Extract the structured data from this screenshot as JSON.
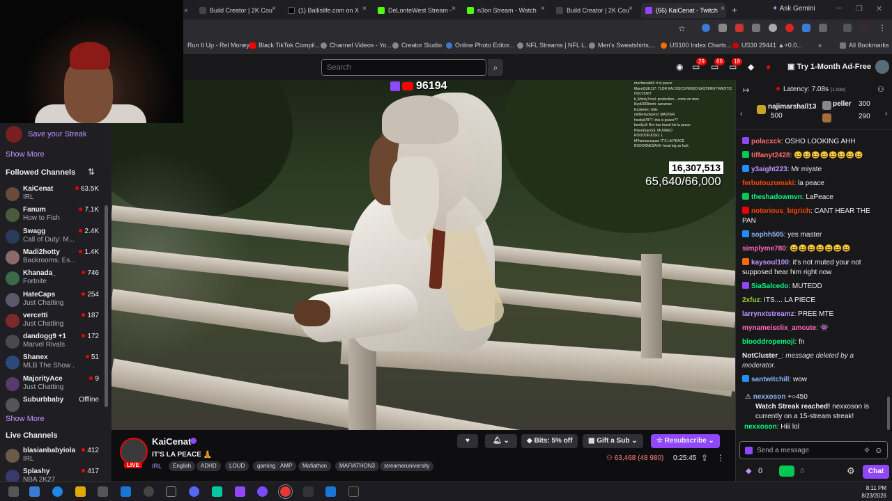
{
  "browser": {
    "tabs": [
      {
        "label": "Build Creator | 2K Cou",
        "color": "#444"
      },
      {
        "label": "(1) Ballislife.com on X",
        "color": "#000"
      },
      {
        "label": "DeLonteWest Stream -",
        "color": "#53fc18"
      },
      {
        "label": "n3on Stream - Watch",
        "color": "#53fc18"
      },
      {
        "label": "Build Creator | 2K Cou",
        "color": "#444"
      },
      {
        "label": "(66) KaiCenat - Twitch",
        "color": "#9146ff"
      }
    ],
    "new_tab": "+",
    "gemini": "Ask Gemini",
    "bookmarks": [
      {
        "label": "Run It Up - Rel Money",
        "color": "#666"
      },
      {
        "label": "Black TikTok Compil...",
        "color": "#ff0000"
      },
      {
        "label": "Channel Videos - Yo...",
        "color": "#888"
      },
      {
        "label": "Creator Studio",
        "color": "#888"
      },
      {
        "label": "Online Photo Editor...",
        "color": "#3a7bd5"
      },
      {
        "label": "NFL Streams | NFL L...",
        "color": "#888"
      },
      {
        "label": "Men's Sweatshirts,...",
        "color": "#888"
      },
      {
        "label": "US100 Index Charts...",
        "color": "#ff6a00"
      },
      {
        "label": "US30 29441 ▲+0.0...",
        "color": "#c00"
      }
    ],
    "all_bookmarks": "All Bookmarks"
  },
  "twitch_nav": {
    "search_placeholder": "Search",
    "badges": [
      "29",
      "66",
      "18"
    ],
    "ad_free": "Try 1-Month Ad-Free"
  },
  "sidebar": {
    "streak": "Save your Streak",
    "show_more_1": "Show More",
    "followed_heading": "Followed Channels",
    "followed": [
      {
        "name": "KaiCenat",
        "game": "IRL",
        "viewers": "63.5K",
        "color": "#6a4a3a"
      },
      {
        "name": "Fanum",
        "game": "How to Fish",
        "viewers": "7.1K",
        "color": "#4a5a3a"
      },
      {
        "name": "Swagg",
        "game": "Call of Duty: M...",
        "viewers": "2.4K",
        "color": "#2a3a5a"
      },
      {
        "name": "Madi2hotty",
        "game": "Backrooms: Es...",
        "viewers": "1.4K",
        "color": "#8a6a6a"
      },
      {
        "name": "Khanada_",
        "game": "Fortnite",
        "viewers": "746",
        "color": "#3a6a4a"
      },
      {
        "name": "HateCaps",
        "game": "Just Chatting",
        "viewers": "254",
        "color": "#5a5a6a"
      },
      {
        "name": "vercetti",
        "game": "Just Chatting",
        "viewers": "187",
        "color": "#7a2a2a"
      },
      {
        "name": "dandogg9 +1",
        "game": "Marvel Rivals",
        "viewers": "172",
        "color": "#4a4a4a"
      },
      {
        "name": "Shanex",
        "game": "MLB The Show ...",
        "viewers": "51",
        "color": "#2a4a7a"
      },
      {
        "name": "MajorityAce",
        "game": "Just Chatting",
        "viewers": "9",
        "color": "#5a3a6a"
      },
      {
        "name": "Suburbbaby",
        "game": "",
        "viewers": "Offline",
        "color": "#555"
      }
    ],
    "show_more_2": "Show More",
    "live_heading": "Live Channels",
    "live": [
      {
        "name": "blasianbabyiola",
        "game": "IRL",
        "viewers": "412",
        "color": "#6a5a4a"
      },
      {
        "name": "Splashy",
        "game": "NBA 2K27",
        "viewers": "417",
        "color": "#3a3a6a"
      }
    ]
  },
  "video": {
    "viewer_total": "96194",
    "goal_count": "16,307,513",
    "goal_progress": "65,640/66,000",
    "overlay_chat": [
      "rbuchenahd1: it is peace",
      "MannQUE117: TLDR KAI DISCOVERED EASTERN TRADITIONS",
      "HOLYSHIT",
      "ti_Monty7cool: production... come on men",
      "lloyd2009mnh: wavwww",
      "EaJamex: vidis",
      "mittlerdudeprod: MASTER",
      "hosikjd7877: this is peace??",
      "bentlyx3: Bro has found his la peace",
      "PlanetSanGS: MUDRED",
      "ROOODRJDSG: L",
      "kPharmacequat: IT'S LA PEACE",
      "BODONNESAXX: head big as fuck"
    ]
  },
  "stream_info": {
    "channel": "KaiCenat",
    "live": "LIVE",
    "title": "IT'S LA PEACE 🧘",
    "category": "IRL",
    "tags": [
      "English",
      "ADHD",
      "LOUD",
      "gaming",
      "AMP",
      "Mafiathon",
      "MAFIATHON3",
      "streameruniversity"
    ],
    "bits": "Bits: 5% off",
    "gift": "Gift a Sub",
    "resub": "Resubscribe",
    "viewers": "63,468 (48 980)",
    "uptime": "0:25:45"
  },
  "chat": {
    "latency": "Latency: 7.08s",
    "latency_sub": "(1.03x)",
    "leaderboard": [
      {
        "name": "najimarshall13",
        "score": "500"
      },
      {
        "name": "peller",
        "score": "300"
      },
      {
        "name": "",
        "score": "290"
      }
    ],
    "messages": [
      {
        "user": "polacxck",
        "color": "#ff6b6b",
        "text": ": OSHO LOOKING AHH",
        "badge": "#9146ff"
      },
      {
        "user": "tiffanyt2428",
        "color": "#ff6b6b",
        "text": ": 😆😆😆😆😆😆😆😆",
        "badge": "#00c853"
      },
      {
        "user": "y3aight223",
        "color": "#bf94ff",
        "text": ": Mr miyate",
        "badge": "#1e90ff"
      },
      {
        "user": "ferbutouzumaki",
        "color": "#ff4500",
        "text": ": la peace",
        "badge": ""
      },
      {
        "user": "theshadowmvn",
        "color": "#00ff7f",
        "text": ": LaPeace",
        "badge": "#00c853"
      },
      {
        "user": "notorious_bigrich",
        "color": "#ff4500",
        "text": ": CANT HEAR THE PAN",
        "badge": "#eb0400"
      },
      {
        "user": "sophh505",
        "color": "#8ab4f8",
        "text": ": yes master",
        "badge": "#1e90ff"
      },
      {
        "user": "simplyme780",
        "color": "#ff69b4",
        "text": ": 😆😆😆😆😆😆😆",
        "badge": ""
      },
      {
        "user": "kaysoul100",
        "color": "#bf94ff",
        "text": ": it's not muted your not supposed hear him right now",
        "badge": "#ff6a00"
      },
      {
        "user": "SiaSalcedo",
        "color": "#00ff7f",
        "text": ": MUTEDD",
        "badge": "#9146ff"
      },
      {
        "user": "2xfuz",
        "color": "#9acd32",
        "text": ": ITS.... LA PIECE",
        "badge": ""
      },
      {
        "user": "larrynxtstreamz",
        "color": "#bf94ff",
        "text": ": PREE MTE",
        "badge": ""
      },
      {
        "user": "mynameisclix_amcute",
        "color": "#ff69b4",
        "text": ": 👾",
        "badge": ""
      },
      {
        "user": "blooddropemoji",
        "color": "#00ff7f",
        "text": ": fn",
        "badge": ""
      },
      {
        "user": "NotCluster_",
        "color": "#efeff1",
        "text": ": message deleted by a moderator.",
        "badge": ""
      },
      {
        "user": "santwitchill",
        "color": "#8ab4f8",
        "text": ": wow",
        "badge": "#1e90ff"
      }
    ],
    "streak_user": "nexxoson",
    "streak_points": "+○450",
    "streak_text": "Watch Streak reached!",
    "streak_detail": " nexxoson is currently on a 15-stream streak!",
    "last_user": "nexxoson",
    "last_text": ": Hiii lol",
    "input_placeholder": "Send a message",
    "bits_count": "0",
    "chat_button": "Chat"
  },
  "taskbar": {
    "time": "8:11 PM",
    "date": "8/23/2026"
  }
}
